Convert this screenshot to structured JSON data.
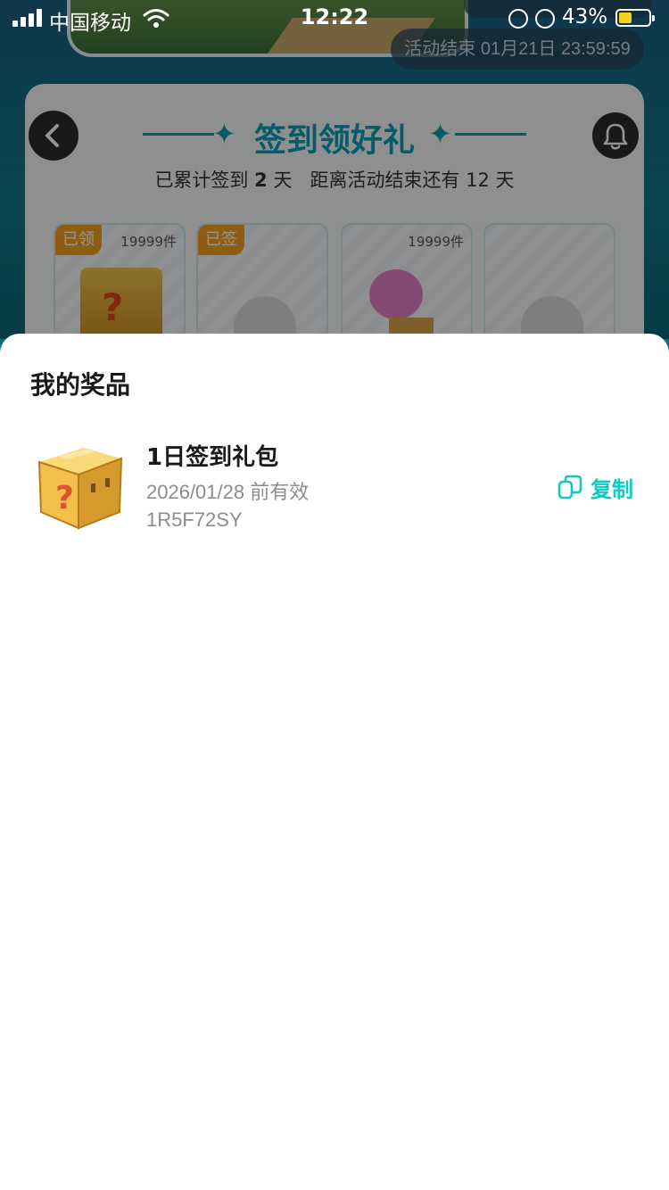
{
  "status_bar": {
    "carrier": "中国移动",
    "time": "12:22",
    "battery_percent": "43%",
    "battery_level": 0.43
  },
  "background": {
    "deadline": "活动结束 01月21日 23:59:59",
    "card_title": "签到领好礼",
    "checkin_prefix": "已累计签到",
    "checkin_days": "2",
    "checkin_suffix": "天",
    "remaining_text": "距离活动结束还有 12 天",
    "slots": [
      {
        "badge": "已领",
        "stock": "19999件"
      },
      {
        "badge": "已签",
        "stock": ""
      },
      {
        "badge": "",
        "stock": "19999件"
      },
      {
        "badge": "",
        "stock": ""
      }
    ]
  },
  "sheet": {
    "title": "我的奖品",
    "prizes": [
      {
        "name": "1日签到礼包",
        "expire": "2026/01/28 前有效",
        "code": "1R5F72SY",
        "copy_label": "复制"
      }
    ]
  },
  "colors": {
    "accent": "#13c9bf",
    "title_teal": "#0b9eb7",
    "badge_orange": "#f6a11b"
  }
}
